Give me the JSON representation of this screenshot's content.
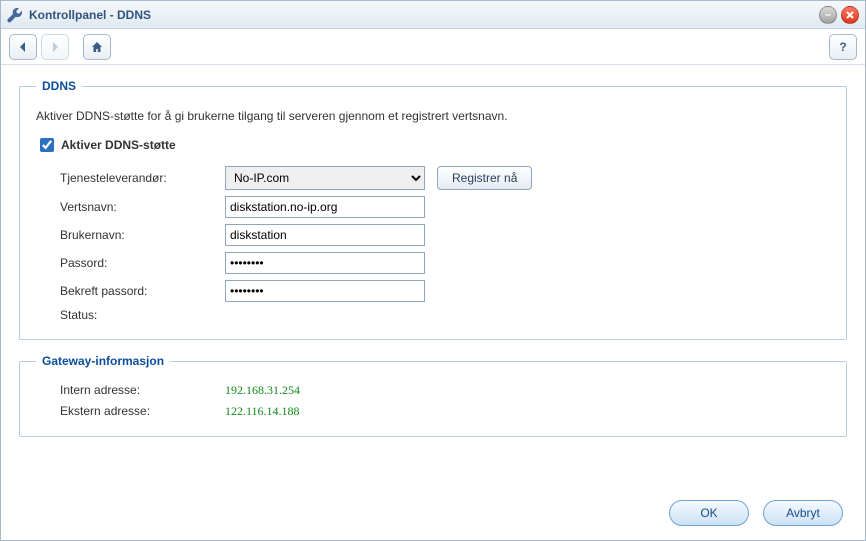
{
  "window": {
    "title": "Kontrollpanel - DDNS"
  },
  "ddns": {
    "legend": "DDNS",
    "description": "Aktiver DDNS-støtte for å gi brukerne tilgang til serveren gjennom et registrert vertsnavn.",
    "enable_label": "Aktiver DDNS-støtte",
    "enable_checked": true,
    "fields": {
      "provider_label": "Tjenesteleverandør:",
      "provider_value": "No-IP.com",
      "register_btn": "Registrer nå",
      "hostname_label": "Vertsnavn:",
      "hostname_value": "diskstation.no-ip.org",
      "username_label": "Brukernavn:",
      "username_value": "diskstation",
      "password_label": "Passord:",
      "password_value": "••••••••",
      "confirm_label": "Bekreft passord:",
      "confirm_value": "••••••••",
      "status_label": "Status:",
      "status_value": ""
    }
  },
  "gateway": {
    "legend": "Gateway-informasjon",
    "internal_label": "Intern adresse:",
    "internal_value": "192.168.31.254",
    "external_label": "Ekstern adresse:",
    "external_value": "122.116.14.188"
  },
  "buttons": {
    "ok": "OK",
    "cancel": "Avbryt"
  }
}
